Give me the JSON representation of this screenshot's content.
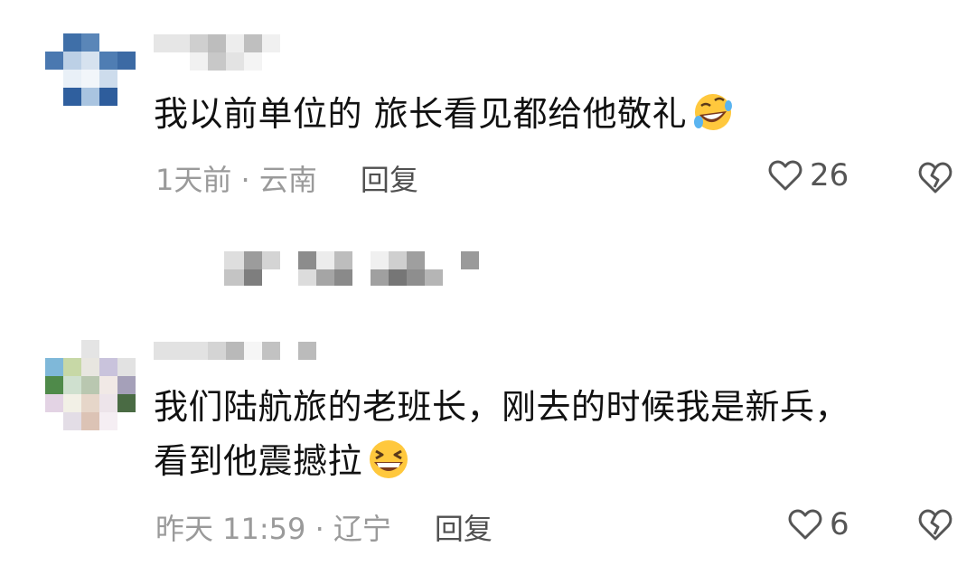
{
  "comments": [
    {
      "text": "我以前单位的  旅长看见都给他敬礼",
      "emoji": "rolling-on-floor-laughing-emoji",
      "time_location": "1天前 · 云南",
      "reply_label": "回复",
      "like_count": "26"
    },
    {
      "text_line1": "我们陆航旅的老班长，刚去的时候我是新兵，",
      "text_line2": "看到他震撼拉",
      "emoji": "laughing-emoji",
      "time_location": "昨天 11:59 · 辽宁",
      "reply_label": "回复",
      "like_count": "6"
    }
  ],
  "colors": {
    "text": "#111111",
    "meta": "#9a9a9a",
    "reply": "#505050",
    "icon": "#555555"
  }
}
